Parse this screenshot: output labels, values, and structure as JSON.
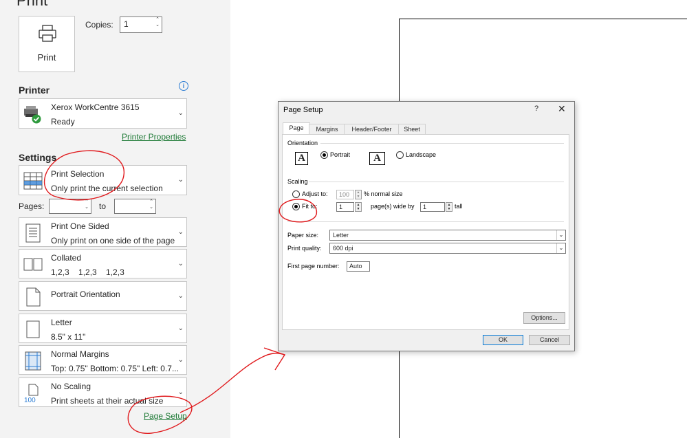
{
  "header": {
    "title": "Print"
  },
  "print_button": {
    "label": "Print",
    "icon": "printer-icon"
  },
  "copies": {
    "label": "Copies:",
    "value": "1"
  },
  "printer": {
    "section_title": "Printer",
    "name": "Xerox WorkCentre 3615",
    "status": "Ready",
    "properties_link": "Printer Properties"
  },
  "settings": {
    "section_title": "Settings",
    "print_what": {
      "line1": "Print Selection",
      "line2": "Only print the current selection"
    },
    "pages": {
      "label": "Pages:",
      "to_label": "to",
      "from_value": "",
      "to_value": ""
    },
    "sides": {
      "line1": "Print One Sided",
      "line2": "Only print on one side of the page"
    },
    "collation": {
      "line1": "Collated",
      "line2": "1,2,3    1,2,3    1,2,3"
    },
    "orientation": {
      "line1": "Portrait Orientation"
    },
    "paper": {
      "line1": "Letter",
      "line2": "8.5\" x 11\""
    },
    "margins": {
      "line1": "Normal Margins",
      "line2": "Top: 0.75\" Bottom: 0.75\" Left: 0.7..."
    },
    "scaling": {
      "line1": "No Scaling",
      "line2": "Print sheets at their actual size",
      "icon_text": "100"
    },
    "page_setup_link": "Page Setup"
  },
  "dialog": {
    "title": "Page Setup",
    "help": "?",
    "close": "✕",
    "tabs": [
      "Page",
      "Margins",
      "Header/Footer",
      "Sheet"
    ],
    "orientation": {
      "group": "Orientation",
      "portrait": "Portrait",
      "landscape": "Landscape",
      "selected": "portrait",
      "icon_glyph": "A"
    },
    "scaling": {
      "group": "Scaling",
      "adjust_label": "Adjust to:",
      "adjust_value": "100",
      "adjust_suffix": "% normal size",
      "fit_label": "Fit to:",
      "fit_wide_value": "1",
      "fit_wide_suffix": "page(s) wide by",
      "fit_tall_value": "1",
      "fit_tall_suffix": "tall",
      "selected": "fit"
    },
    "paper_size": {
      "label": "Paper size:",
      "value": "Letter"
    },
    "print_quality": {
      "label": "Print quality:",
      "value": "600 dpi"
    },
    "first_page": {
      "label": "First page number:",
      "value": "Auto"
    },
    "options_button": "Options...",
    "ok_button": "OK",
    "cancel_button": "Cancel"
  },
  "colors": {
    "annotation": "#e0191c",
    "link": "#1e7a36",
    "accent": "#0078d7"
  }
}
